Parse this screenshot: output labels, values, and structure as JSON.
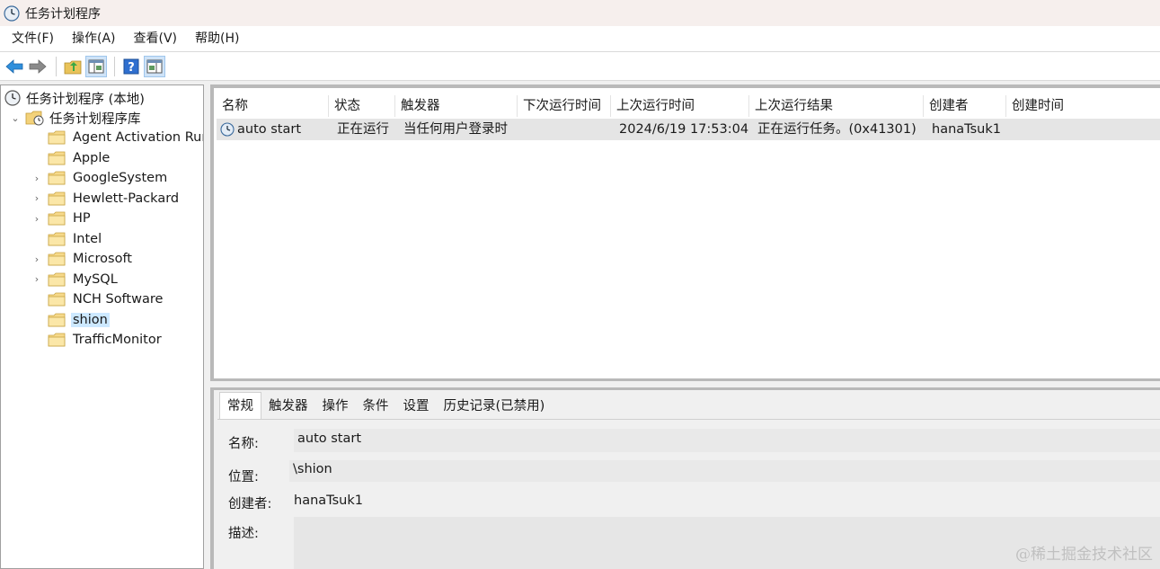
{
  "window": {
    "title": "任务计划程序"
  },
  "menu": [
    "文件(F)",
    "操作(A)",
    "查看(V)",
    "帮助(H)"
  ],
  "toolbar": {
    "icons": [
      "back-arrow-icon",
      "forward-arrow-icon",
      "up-folder-icon",
      "show-hide-console-tree-icon",
      "help-icon",
      "show-hide-action-pane-icon"
    ]
  },
  "tree": {
    "root": "任务计划程序 (本地)",
    "library": "任务计划程序库",
    "folders": [
      {
        "label": "Agent Activation Run",
        "expandable": false
      },
      {
        "label": "Apple",
        "expandable": false
      },
      {
        "label": "GoogleSystem",
        "expandable": true
      },
      {
        "label": "Hewlett-Packard",
        "expandable": true
      },
      {
        "label": "HP",
        "expandable": true
      },
      {
        "label": "Intel",
        "expandable": false
      },
      {
        "label": "Microsoft",
        "expandable": true
      },
      {
        "label": "MySQL",
        "expandable": true
      },
      {
        "label": "NCH Software",
        "expandable": false
      },
      {
        "label": "shion",
        "expandable": false,
        "selected": true
      },
      {
        "label": "TrafficMonitor",
        "expandable": false
      }
    ]
  },
  "task_list": {
    "columns": [
      "名称",
      "状态",
      "触发器",
      "下次运行时间",
      "上次运行时间",
      "上次运行结果",
      "创建者",
      "创建时间"
    ],
    "rows": [
      {
        "name": "auto start",
        "status": "正在运行",
        "trigger": "当任何用户登录时",
        "next_run": "",
        "last_run": "2024/6/19 17:53:04",
        "last_result": "正在运行任务。(0x41301)",
        "author": "hanaTsuk1",
        "created": ""
      }
    ]
  },
  "detail": {
    "tabs": [
      "常规",
      "触发器",
      "操作",
      "条件",
      "设置",
      "历史记录(已禁用)"
    ],
    "active_tab": "常规",
    "name_label": "名称:",
    "name_value": "auto start",
    "location_label": "位置:",
    "location_value": "\\shion",
    "author_label": "创建者:",
    "author_value": "hanaTsuk1",
    "description_label": "描述:",
    "description_value": ""
  },
  "watermark": "@稀土掘金技术社区",
  "colors": {
    "selection": "#cce8ff",
    "row_highlight": "#e5e5e5",
    "titlebar": "#f6efed"
  }
}
